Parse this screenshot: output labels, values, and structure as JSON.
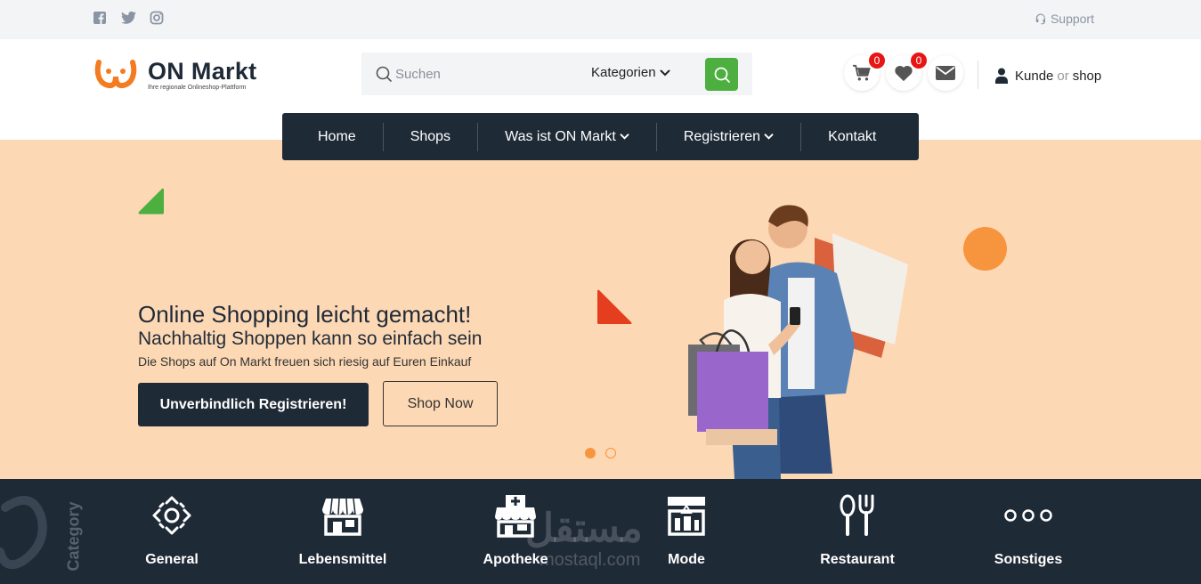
{
  "topbar": {
    "support_label": "Support"
  },
  "brand": {
    "name": "ON Markt",
    "tagline": "Ihre regionale Onlineshop-Plattform",
    "accent": "#f47b20"
  },
  "search": {
    "placeholder": "Suchen",
    "category_label": "Kategorien"
  },
  "header": {
    "cart_count": "0",
    "wishlist_count": "0",
    "user_kunde": "Kunde",
    "user_or": "or",
    "user_shop": "shop"
  },
  "nav": {
    "items": [
      {
        "label": "Home"
      },
      {
        "label": "Shops"
      },
      {
        "label": "Was ist ON Markt"
      },
      {
        "label": "Registrieren"
      },
      {
        "label": "Kontakt"
      }
    ]
  },
  "hero": {
    "headline": "Online Shopping leicht gemacht!",
    "subheadline": "Nachhaltig Shoppen kann so einfach sein",
    "text": "Die Shops auf On Markt freuen sich riesig auf Euren Einkauf",
    "register_button": "Unverbindlich Registrieren!",
    "shop_button": "Shop Now",
    "slides_total": 2,
    "slide_active": 1
  },
  "categories": {
    "heading": "Category",
    "items": [
      {
        "label": "General",
        "icon": "location-target-icon"
      },
      {
        "label": "Lebensmittel",
        "icon": "storefront-icon"
      },
      {
        "label": "Apotheke",
        "icon": "pharmacy-icon"
      },
      {
        "label": "Mode",
        "icon": "fashion-shop-icon"
      },
      {
        "label": "Restaurant",
        "icon": "cutlery-icon"
      },
      {
        "label": "Sonstiges",
        "icon": "more-dots-icon"
      }
    ]
  },
  "watermark": {
    "arabic": "مستقل",
    "latin": "mostaql.com"
  },
  "colors": {
    "dark": "#1f2a37",
    "hero_bg": "#fdd8b4",
    "green": "#4caf3f",
    "orange": "#f7953f",
    "red_badge": "#e81515"
  }
}
